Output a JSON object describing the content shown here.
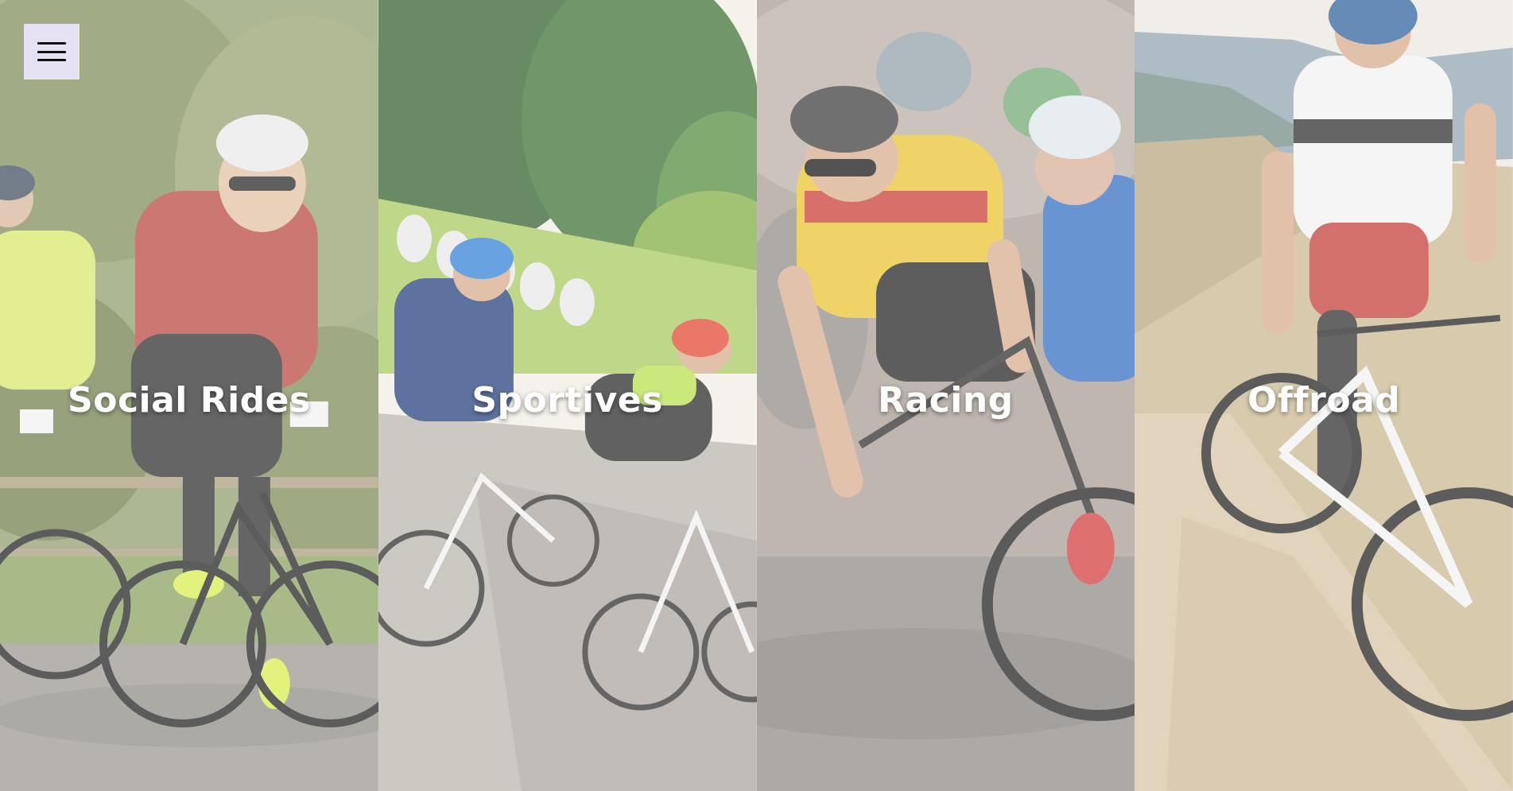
{
  "menu": {
    "icon": "hamburger-menu-icon"
  },
  "panels": [
    {
      "title": "Social Rides",
      "image": "social-rides-photo",
      "accent": "#c43a34"
    },
    {
      "title": "Sportives",
      "image": "sportives-photo",
      "accent": "#2b6cc4"
    },
    {
      "title": "Racing",
      "image": "racing-photo",
      "accent": "#e9c428"
    },
    {
      "title": "Offroad",
      "image": "offroad-photo",
      "accent": "#c9b083"
    }
  ]
}
